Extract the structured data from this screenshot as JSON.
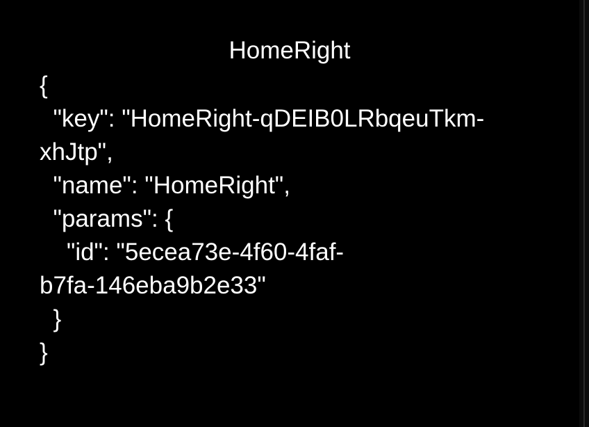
{
  "screen": {
    "title": "HomeRight",
    "json_lines": [
      "{",
      "  \"key\": \"HomeRight-qDEIB0LRbqeuTkm-",
      "xhJtp\",",
      "  \"name\": \"HomeRight\",",
      "  \"params\": {",
      "    \"id\": \"5ecea73e-4f60-4faf-",
      "b7fa-146eba9b2e33\"",
      "  }",
      "}"
    ]
  },
  "colors": {
    "background": "#000000",
    "text": "#ffffff"
  }
}
